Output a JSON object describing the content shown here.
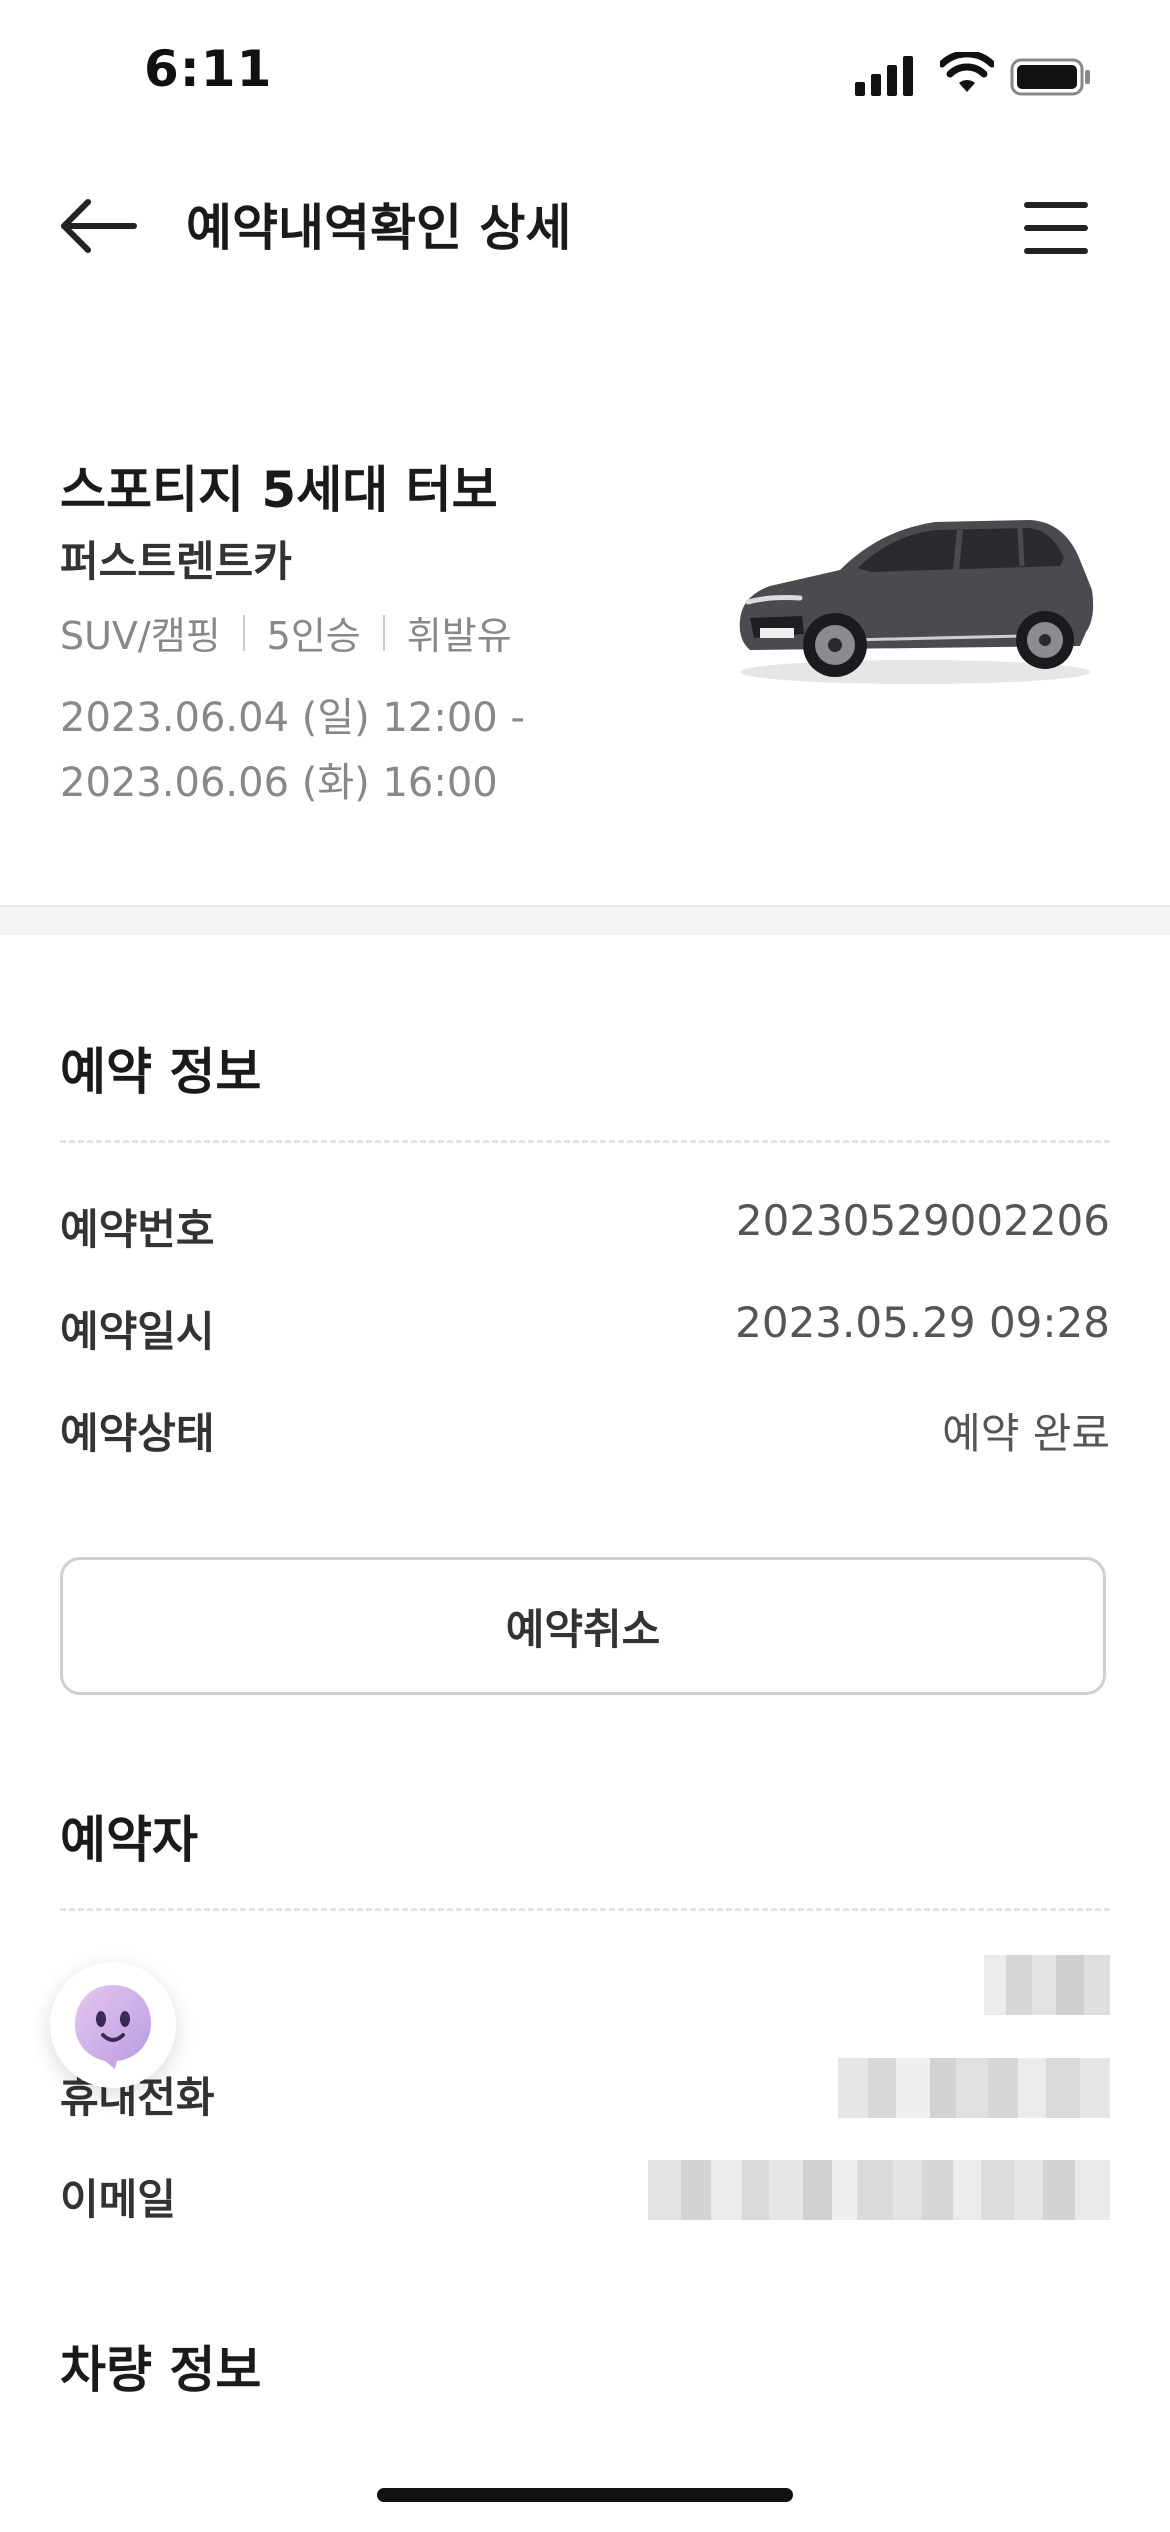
{
  "status_bar": {
    "time": "6:11"
  },
  "header": {
    "title": "예약내역확인 상세"
  },
  "car": {
    "name": "스포티지 5세대 터보",
    "company": "퍼스트렌트카",
    "tags": [
      "SUV/캠핑",
      "5인승",
      "휘발유"
    ],
    "period_start": "2023.06.04 (일) 12:00 -",
    "period_end": "2023.06.06 (화) 16:00"
  },
  "reservation": {
    "title": "예약 정보",
    "rows": [
      {
        "label": "예약번호",
        "value": "20230529002206"
      },
      {
        "label": "예약일시",
        "value": "2023.05.29 09:28"
      },
      {
        "label": "예약상태",
        "value": "예약 완료"
      }
    ],
    "cancel_label": "예약취소"
  },
  "booker": {
    "title": "예약자",
    "rows": [
      {
        "label": "",
        "value": ""
      },
      {
        "label": "휴대전화",
        "value": ""
      },
      {
        "label": "이메일",
        "value": ""
      }
    ]
  },
  "vehicle_info": {
    "title": "차량 정보"
  }
}
